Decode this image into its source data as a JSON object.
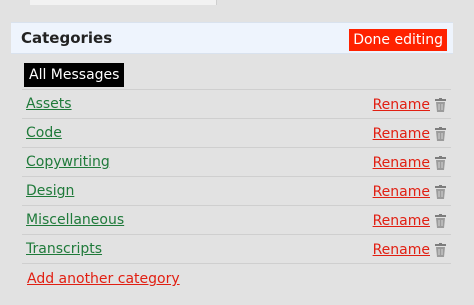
{
  "panel": {
    "title": "Categories",
    "done_label": "Done editing"
  },
  "all_messages_label": "All Messages",
  "categories": [
    {
      "name": "Assets",
      "rename_label": "Rename",
      "delete_icon": "trash-icon"
    },
    {
      "name": "Code",
      "rename_label": "Rename",
      "delete_icon": "trash-icon"
    },
    {
      "name": "Copywriting",
      "rename_label": "Rename",
      "delete_icon": "trash-icon"
    },
    {
      "name": "Design",
      "rename_label": "Rename",
      "delete_icon": "trash-icon"
    },
    {
      "name": "Miscellaneous",
      "rename_label": "Rename",
      "delete_icon": "trash-icon"
    },
    {
      "name": "Transcripts",
      "rename_label": "Rename",
      "delete_icon": "trash-icon"
    }
  ],
  "add_category_label": "Add another category",
  "colors": {
    "done_button_bg": "#ff2200",
    "category_link": "#1f7a3a",
    "action_link": "#e11f12",
    "header_bg": "#eef4fd"
  }
}
